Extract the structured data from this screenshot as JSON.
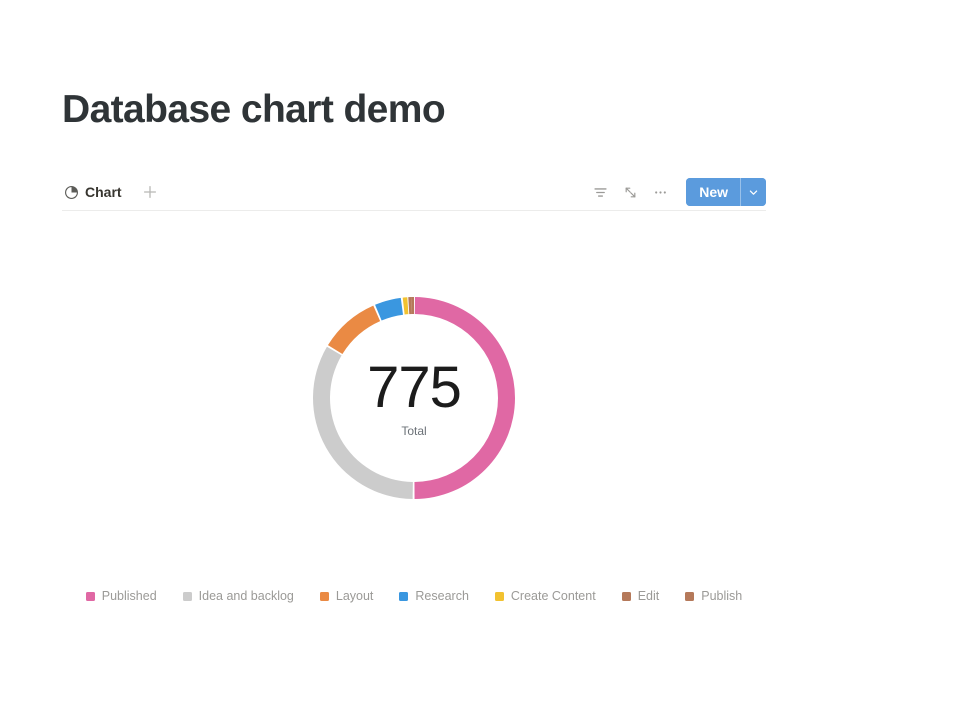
{
  "page": {
    "title": "Database chart demo",
    "background": "#ffffff"
  },
  "toolbar": {
    "view_tab_label": "Chart",
    "view_tab_icon": "pie-chart-icon",
    "add_view_icon": "plus-icon",
    "filter_icon": "filter-sort-icon",
    "expand_icon": "collapse-arrows-icon",
    "more_icon": "more-horizontal-icon",
    "new_label": "New",
    "new_caret_icon": "chevron-down-icon",
    "new_button_color": "#5b9bdd"
  },
  "chart_data": {
    "type": "pie",
    "title": "",
    "subtitle": "",
    "variant": "donut",
    "center_value": "775",
    "center_label": "Total",
    "total": 775,
    "start_angle": 0,
    "direction": "clockwise",
    "legend_position": "bottom",
    "grid": false,
    "categories": [
      "Published",
      "Idea and backlog",
      "Layout",
      "Research",
      "Create Content",
      "Edit",
      "Publish"
    ],
    "values": [
      388,
      260,
      77,
      35,
      8,
      4,
      3
    ],
    "colors": [
      "#e068a4",
      "#cccccc",
      "#ea8a44",
      "#3a97e0",
      "#f2c230",
      "#b5795a",
      "#b5795a"
    ],
    "slices": [
      {
        "label": "Published",
        "value": 388,
        "color": "#e068a4",
        "percent": 50.1
      },
      {
        "label": "Idea and backlog",
        "value": 260,
        "color": "#cccccc",
        "percent": 33.5
      },
      {
        "label": "Layout",
        "value": 77,
        "color": "#ea8a44",
        "percent": 9.9
      },
      {
        "label": "Research",
        "value": 35,
        "color": "#3a97e0",
        "percent": 4.5
      },
      {
        "label": "Create Content",
        "value": 8,
        "color": "#f2c230",
        "percent": 1.0
      },
      {
        "label": "Edit",
        "value": 4,
        "color": "#b5795a",
        "percent": 0.5
      },
      {
        "label": "Publish",
        "value": 3,
        "color": "#b5795a",
        "percent": 0.4
      }
    ]
  },
  "legend": {
    "items": [
      {
        "label": "Published",
        "color": "#e068a4"
      },
      {
        "label": "Idea and backlog",
        "color": "#cccccc"
      },
      {
        "label": "Layout",
        "color": "#ea8a44"
      },
      {
        "label": "Research",
        "color": "#3a97e0"
      },
      {
        "label": "Create Content",
        "color": "#f2c230"
      },
      {
        "label": "Edit",
        "color": "#b5795a"
      },
      {
        "label": "Publish",
        "color": "#b5795a"
      }
    ]
  }
}
